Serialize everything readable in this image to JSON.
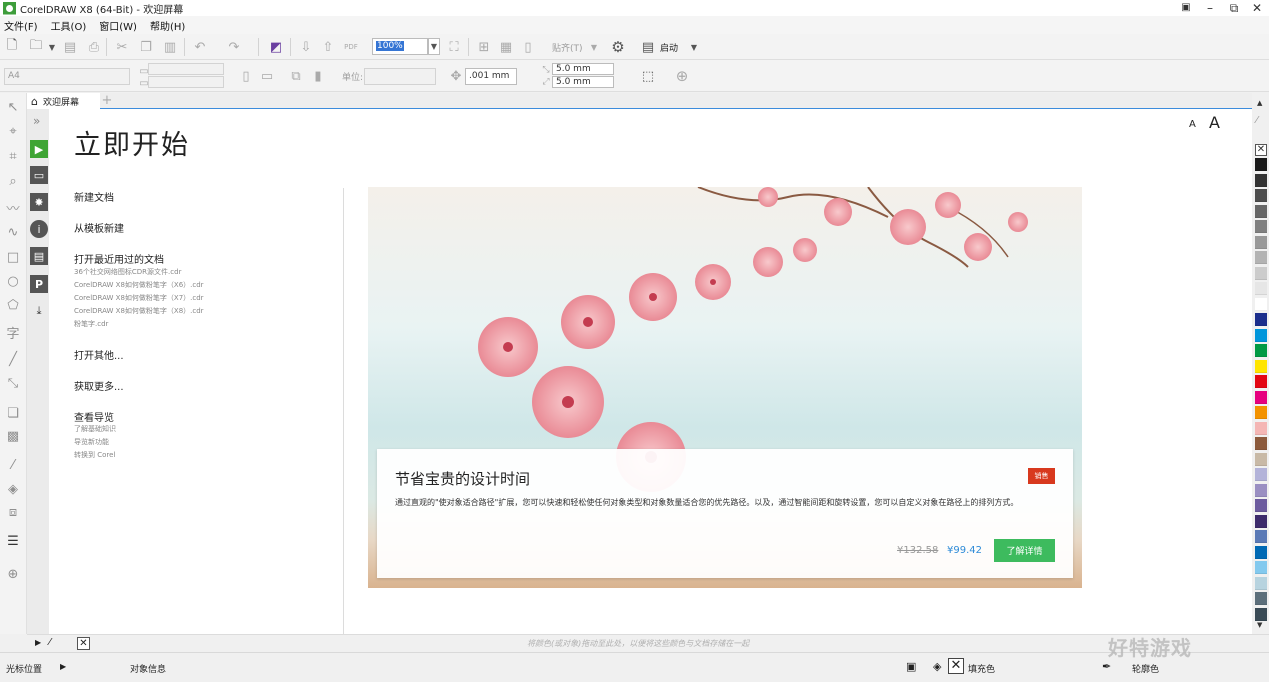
{
  "window": {
    "title": "CorelDRAW X8 (64-Bit) - 欢迎屏幕",
    "minimize": "–",
    "restore": "⧉",
    "close": "✕"
  },
  "menu": [
    "文件(F)",
    "工具(O)",
    "窗口(W)",
    "帮助(H)"
  ],
  "toolbar": {
    "zoom_value": "100%",
    "snap_label": "贴齐(T)",
    "launch_label": "启动"
  },
  "property_bar": {
    "page_size": "A4",
    "units_label": "单位:",
    "nudge_value": ".001 mm",
    "dup_x": "5.0 mm",
    "dup_y": "5.0 mm"
  },
  "tabs": [
    {
      "label": "欢迎屏幕"
    }
  ],
  "welcome": {
    "heading": "立即开始",
    "new_doc": "新建文档",
    "from_template": "从模板新建",
    "open_recent": "打开最近用过的文档",
    "recent_files": [
      "36个社交网络图标CDR源文件.cdr",
      "CorelDRAW X8如何做粉笔字（X6）.cdr",
      "CorelDRAW X8如何做粉笔字（X7）.cdr",
      "CorelDRAW X8如何做粉笔字（X8）.cdr",
      "粉笔字.cdr"
    ],
    "open_other": "打开其他...",
    "get_more": "获取更多...",
    "tour": "查看导览",
    "tour_links": [
      "了解基础知识",
      "导览新功能",
      "转换到 Corel"
    ],
    "font_small": "A",
    "font_large": "A"
  },
  "promo": {
    "title": "节省宝贵的设计时间",
    "badge": "销售",
    "description": "通过直观的\"使对象适合路径\"扩展，您可以快速和轻松使任何对象类型和对象数量适合您的优先路径。以及，通过智能间距和旋转设置，您可以自定义对象在路径上的排列方式。",
    "old_price": "¥132.58",
    "new_price": "¥99.42",
    "button": "了解详情"
  },
  "doc_palette_hint": "将颜色(或对象)拖动至此处，以便将这些颜色与文档存储在一起",
  "status": {
    "cursor_pos": "光标位置",
    "object_info": "对象信息",
    "fill_label": "填充色",
    "outline_label": "轮廓色"
  },
  "watermark": "好特游戏",
  "palette_colors": [
    "#1a1a1a",
    "#333333",
    "#4d4d4d",
    "#666666",
    "#808080",
    "#999999",
    "#b3b3b3",
    "#cccccc",
    "#e6e6e6",
    "#ffffff",
    "#1b2e8c",
    "#0096db",
    "#009a44",
    "#ffe500",
    "#e30613",
    "#e6007e",
    "#f39200",
    "#f4b6b4",
    "#8c5a3c",
    "#c8b9a6",
    "#b3b3d9",
    "#9a8fc2",
    "#6c5b9e",
    "#3d2b6b",
    "#5b7ab6",
    "#0069b4",
    "#83c9ee",
    "#b7d3df",
    "#5c6f7b",
    "#3a4b56"
  ]
}
